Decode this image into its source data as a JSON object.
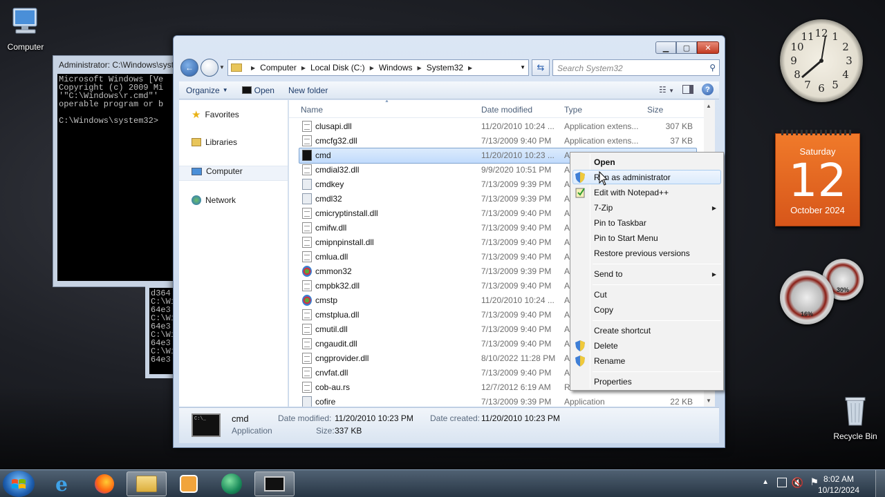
{
  "desktop": {
    "icons": [
      {
        "label": "Computer"
      },
      {
        "label": "Recycle Bin"
      }
    ]
  },
  "gadgets": {
    "clock_numbers": [
      "12",
      "1",
      "2",
      "3",
      "4",
      "5",
      "6",
      "7",
      "8",
      "9",
      "10",
      "11"
    ],
    "calendar": {
      "weekday": "Saturday",
      "day": "12",
      "month_year": "October 2024"
    },
    "meters": [
      {
        "value": "16%"
      },
      {
        "value": "30%"
      }
    ]
  },
  "console": {
    "title": "Administrator: C:\\Windows\\system32\\cmd.exe",
    "lines": [
      "Microsoft Windows [Ve",
      "Copyright (c) 2009 Mi",
      "'\"C:\\Windows\\r.cmd\"'",
      "operable program or b",
      "",
      "C:\\Windows\\system32>"
    ],
    "lines2": [
      "d364",
      "C:\\Wi",
      "64e3",
      "C:\\Wi",
      "64e3",
      "C:\\Wi",
      "64e3",
      "C:\\Wi",
      "64e3"
    ]
  },
  "explorer": {
    "address": [
      "Computer",
      "Local Disk (C:)",
      "Windows",
      "System32"
    ],
    "search_placeholder": "Search System32",
    "toolbar": {
      "organize": "Organize",
      "open": "Open",
      "new_folder": "New folder"
    },
    "nav": {
      "favorites": "Favorites",
      "libraries": "Libraries",
      "computer": "Computer",
      "network": "Network"
    },
    "columns": {
      "name": "Name",
      "date": "Date modified",
      "type": "Type",
      "size": "Size"
    },
    "files": [
      {
        "name": "clusapi.dll",
        "date": "11/20/2010 10:24 ...",
        "type": "Application extens...",
        "size": "307 KB",
        "icon": "doc"
      },
      {
        "name": "cmcfg32.dll",
        "date": "7/13/2009 9:40 PM",
        "type": "Application extens...",
        "size": "37 KB",
        "icon": "doc"
      },
      {
        "name": "cmd",
        "date": "11/20/2010 10:23 ...",
        "type": "Application",
        "size": "337 KB",
        "icon": "cmd"
      },
      {
        "name": "cmdial32.dll",
        "date": "9/9/2020 10:51 PM",
        "type": "A",
        "size": "",
        "icon": "doc"
      },
      {
        "name": "cmdkey",
        "date": "7/13/2009 9:39 PM",
        "type": "A",
        "size": "",
        "icon": "exe"
      },
      {
        "name": "cmdl32",
        "date": "7/13/2009 9:39 PM",
        "type": "A",
        "size": "",
        "icon": "exe"
      },
      {
        "name": "cmicryptinstall.dll",
        "date": "7/13/2009 9:40 PM",
        "type": "A",
        "size": "",
        "icon": "doc"
      },
      {
        "name": "cmifw.dll",
        "date": "7/13/2009 9:40 PM",
        "type": "A",
        "size": "",
        "icon": "doc"
      },
      {
        "name": "cmipnpinstall.dll",
        "date": "7/13/2009 9:40 PM",
        "type": "A",
        "size": "",
        "icon": "doc"
      },
      {
        "name": "cmlua.dll",
        "date": "7/13/2009 9:40 PM",
        "type": "A",
        "size": "",
        "icon": "doc"
      },
      {
        "name": "cmmon32",
        "date": "7/13/2009 9:39 PM",
        "type": "A",
        "size": "",
        "icon": "gear"
      },
      {
        "name": "cmpbk32.dll",
        "date": "7/13/2009 9:40 PM",
        "type": "A",
        "size": "",
        "icon": "doc"
      },
      {
        "name": "cmstp",
        "date": "11/20/2010 10:24 ...",
        "type": "A",
        "size": "",
        "icon": "gear"
      },
      {
        "name": "cmstplua.dll",
        "date": "7/13/2009 9:40 PM",
        "type": "A",
        "size": "",
        "icon": "doc"
      },
      {
        "name": "cmutil.dll",
        "date": "7/13/2009 9:40 PM",
        "type": "A",
        "size": "",
        "icon": "doc"
      },
      {
        "name": "cngaudit.dll",
        "date": "7/13/2009 9:40 PM",
        "type": "A",
        "size": "",
        "icon": "doc"
      },
      {
        "name": "cngprovider.dll",
        "date": "8/10/2022 11:28 PM",
        "type": "A",
        "size": "",
        "icon": "doc"
      },
      {
        "name": "cnvfat.dll",
        "date": "7/13/2009 9:40 PM",
        "type": "A",
        "size": "",
        "icon": "doc"
      },
      {
        "name": "cob-au.rs",
        "date": "12/7/2012 6:19 AM",
        "type": "R",
        "size": "",
        "icon": "blank"
      },
      {
        "name": "cofire",
        "date": "7/13/2009 9:39 PM",
        "type": "Application",
        "size": "22 KB",
        "icon": "exe"
      }
    ],
    "details": {
      "name": "cmd",
      "kind": "Application",
      "modified_label": "Date modified:",
      "modified": "11/20/2010 10:23 PM",
      "created_label": "Date created:",
      "created": "11/20/2010 10:23 PM",
      "size_label": "Size:",
      "size": "337 KB"
    }
  },
  "context_menu": {
    "items": [
      "Open",
      "Run as administrator",
      "Edit with Notepad++",
      "7-Zip",
      "Pin to Taskbar",
      "Pin to Start Menu",
      "Restore previous versions",
      "Send to",
      "Cut",
      "Copy",
      "Create shortcut",
      "Delete",
      "Rename",
      "Properties"
    ]
  },
  "taskbar": {
    "time": "8:02 AM",
    "date": "10/12/2024"
  },
  "colors": {
    "selection": "#c1dbfc",
    "calendar": "#e8661f",
    "taskbar": "#3c5063"
  }
}
